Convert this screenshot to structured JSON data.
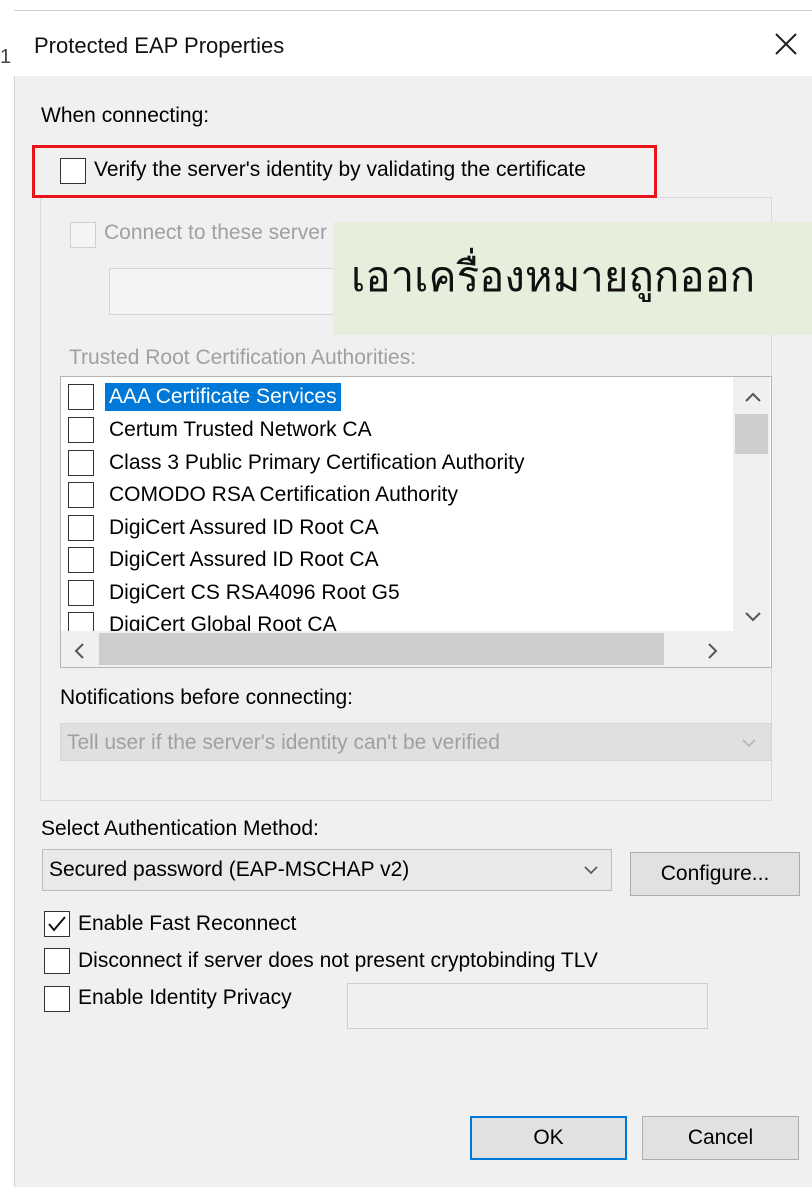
{
  "window": {
    "title": "Protected EAP Properties",
    "close_icon": "close-icon",
    "edge_char": "1"
  },
  "connecting": {
    "heading": "When connecting:",
    "verify_label": "Verify the server's identity by validating the certificate",
    "verify_checked": false,
    "connect_servers_label": "Connect to these server",
    "connect_servers_value": ""
  },
  "banner": {
    "text": "เอาเครื่องหมายถูกออก",
    "color": "#e6efdb"
  },
  "trusted_ca": {
    "heading": "Trusted Root Certification Authorities:",
    "items": [
      {
        "label": "AAA Certificate Services",
        "checked": false,
        "selected": true
      },
      {
        "label": "Certum Trusted Network CA",
        "checked": false,
        "selected": false
      },
      {
        "label": "Class 3 Public Primary Certification Authority",
        "checked": false,
        "selected": false
      },
      {
        "label": "COMODO RSA Certification Authority",
        "checked": false,
        "selected": false
      },
      {
        "label": "DigiCert Assured ID Root CA",
        "checked": false,
        "selected": false
      },
      {
        "label": "DigiCert Assured ID Root CA",
        "checked": false,
        "selected": false
      },
      {
        "label": "DigiCert CS RSA4096 Root G5",
        "checked": false,
        "selected": false
      },
      {
        "label": "DigiCert Global Root CA",
        "checked": false,
        "selected": false
      }
    ]
  },
  "notifications": {
    "heading": "Notifications before connecting:",
    "selected": "Tell user if the server's identity can't be verified"
  },
  "auth": {
    "heading": "Select Authentication Method:",
    "selected": "Secured password (EAP-MSCHAP v2)",
    "configure_label": "Configure..."
  },
  "options": {
    "fast_reconnect_label": "Enable Fast Reconnect",
    "fast_reconnect_checked": true,
    "disconnect_label": "Disconnect if server does not present cryptobinding TLV",
    "disconnect_checked": false,
    "identity_privacy_label": "Enable Identity Privacy",
    "identity_privacy_checked": false,
    "identity_privacy_value": ""
  },
  "buttons": {
    "ok_label": "OK",
    "cancel_label": "Cancel"
  },
  "colors": {
    "highlight": "#e8131b",
    "selection": "#0078d7"
  }
}
